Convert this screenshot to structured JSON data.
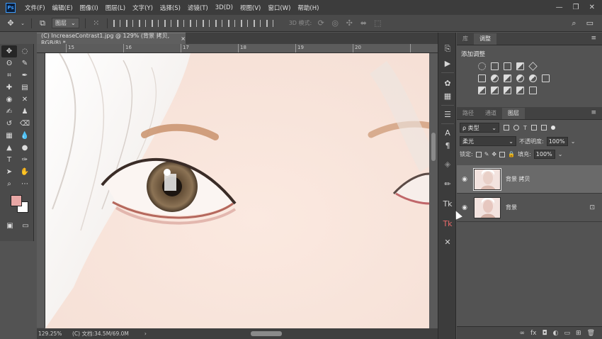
{
  "app": {
    "logo": "Ps"
  },
  "menu": [
    "文件(F)",
    "编辑(E)",
    "图像(I)",
    "图层(L)",
    "文字(Y)",
    "选择(S)",
    "滤镜(T)",
    "3D(D)",
    "视图(V)",
    "窗口(W)",
    "帮助(H)"
  ],
  "window_controls": [
    "—",
    "❐",
    "✕"
  ],
  "options_bar": {
    "auto_select_target": "图层",
    "mode_3d_label": "3D 模式:"
  },
  "document": {
    "tab_title": "(C) IncreaseContrast1.jpg @ 129% (背景 拷贝, RGB/8) *",
    "tab_close": "×",
    "ruler_top": [
      "15",
      "16",
      "17",
      "18",
      "19",
      "20"
    ],
    "status_zoom": "129.25%",
    "status_doc": "(C) 文档:34.5M/69.0M",
    "status_arrow": "›"
  },
  "panels": {
    "top_tabs": [
      "库",
      "调整"
    ],
    "top_active": 1,
    "adjustments_title": "添加调整",
    "layers_tabs": [
      "路径",
      "通道",
      "图层"
    ],
    "layers_active": 2,
    "kind_filter": "ρ 类型",
    "blend_mode": "柔光",
    "opacity_label": "不透明度:",
    "opacity_value": "100%",
    "lock_label": "锁定:",
    "fill_label": "填充:",
    "fill_value": "100%",
    "layers": [
      {
        "name": "背景 拷贝",
        "selected": true,
        "locked": false
      },
      {
        "name": "背景",
        "selected": false,
        "locked": true
      }
    ],
    "footer_icons": [
      "link-icon",
      "fx-icon",
      "mask-icon",
      "adjustment-icon",
      "folder-icon",
      "new-layer-icon",
      "trash-icon"
    ],
    "footer_fx": "fx"
  },
  "colors": {
    "foreground": "#e8a7a5",
    "background": "#ffffff",
    "accent": "#3b9cff"
  }
}
